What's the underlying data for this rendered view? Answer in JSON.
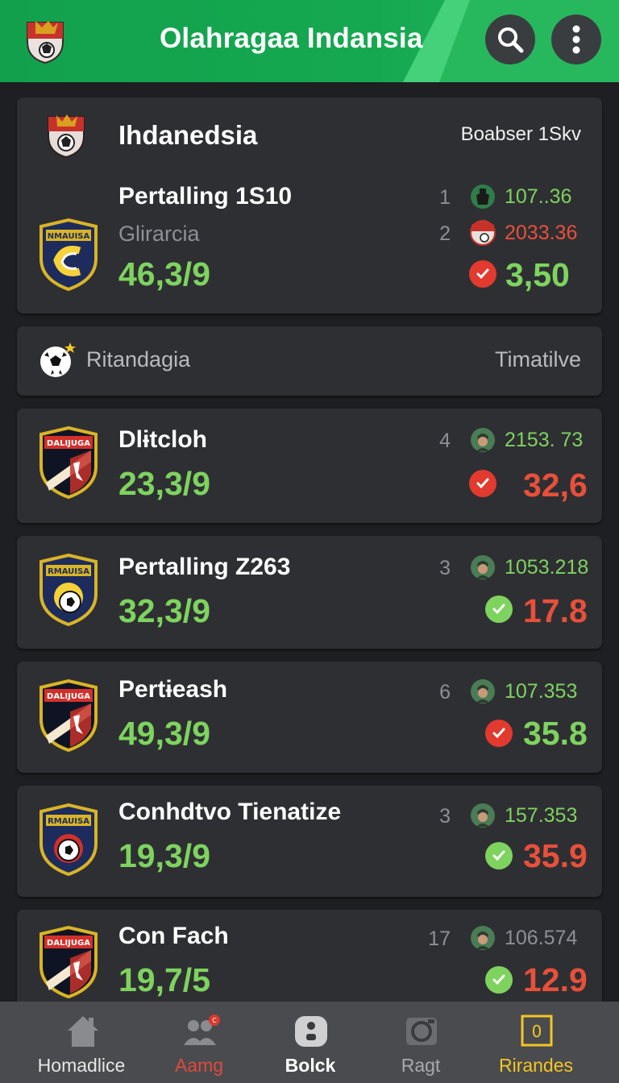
{
  "header": {
    "title": "Olahragaa Indansia"
  },
  "league": {
    "name": "Ihdanedsia",
    "label": "Boabser 1Skv"
  },
  "featured": {
    "name": "Pertalling 1S10",
    "subtitle": "Glirarcia",
    "score": "46,3/9",
    "rank1": "1",
    "odd1": "107..36",
    "rank2": "2",
    "odd2": "2033.36",
    "main_odd": "3,50"
  },
  "section": {
    "title": "Ritandagia",
    "label": "Timatilve"
  },
  "teams": [
    {
      "name": "Dlɨtcloh",
      "score": "23,3/9",
      "rank": "4",
      "small_odd": "2153. 73",
      "odd": "32,6"
    },
    {
      "name": "Pertalling Z263",
      "score": "32,3/9",
      "rank": "3",
      "small_odd": "1053.218",
      "odd": "17.8"
    },
    {
      "name": "Pertɨeash",
      "score": "49,3/9",
      "rank": "6",
      "small_odd": "107.353",
      "odd": "35.8"
    },
    {
      "name": "Conhdtvo Tienatize",
      "score": "19,3/9",
      "rank": "3",
      "small_odd": "157.353",
      "odd": "35.9"
    },
    {
      "name": "Con Fach",
      "score": "19,7/5",
      "rank": "17",
      "small_odd": "106.574",
      "odd": "12.9"
    }
  ],
  "nav": [
    {
      "label": "Homadlice"
    },
    {
      "label": "Aamg"
    },
    {
      "label": "Bolck"
    },
    {
      "label": "Ragt"
    },
    {
      "label": "Rirandes"
    }
  ],
  "colors": {
    "header_green": "#16a851",
    "score_green": "#7ed35f",
    "odd_red": "#e8503a",
    "card_bg": "#2e2f33",
    "nav_active": "#f3c623"
  }
}
